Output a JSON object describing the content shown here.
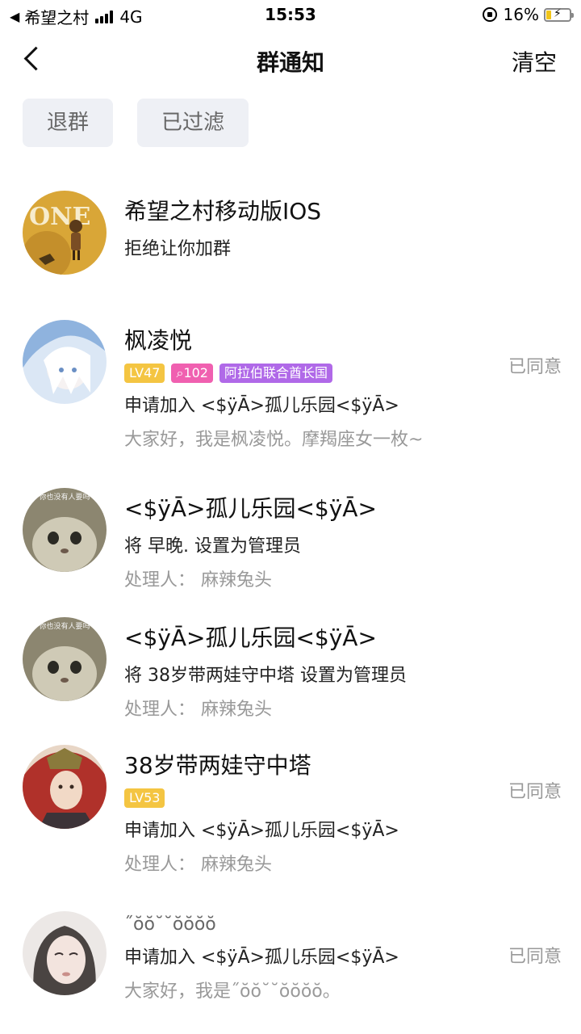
{
  "status_bar": {
    "carrier": "希望之村",
    "network": "4G",
    "time": "15:53",
    "battery": "16%"
  },
  "nav": {
    "title": "群通知",
    "clear_label": "清空"
  },
  "filters": [
    "退群",
    "已过滤"
  ],
  "colors": {
    "level_badge": "#f4c542",
    "search_badge": "#f060b0",
    "region_badge": "#b069e8",
    "chip_bg": "#eef0f5",
    "status_text": "#999999"
  },
  "items": [
    {
      "title": "希望之村移动版IOS",
      "line1": "拒绝让你加群"
    },
    {
      "title": "枫凌悦",
      "level": "LV47",
      "search_count": "102",
      "region": "阿拉伯联合酋长国",
      "line1": "申请加入 <$ÿĀ>孤儿乐园<$ÿĀ>",
      "line2": "大家好，我是枫凌悦。摩羯座女一枚~",
      "status": "已同意"
    },
    {
      "title": "<$ÿĀ>孤儿乐园<$ÿĀ>",
      "line1": "将 早晚. 设置为管理员",
      "line2": "处理人：  麻辣兔头",
      "avatar_caption": "你也没有人要吗"
    },
    {
      "title": "<$ÿĀ>孤儿乐园<$ÿĀ>",
      "line1": "将 38岁带两娃守中塔 设置为管理员",
      "line2": "处理人：  麻辣兔头",
      "avatar_caption": "你也没有人要吗"
    },
    {
      "title": "38岁带两娃守中塔",
      "level": "LV53",
      "line1": "申请加入 <$ÿĀ>孤儿乐园<$ÿĀ>",
      "line2": "处理人：  麻辣兔头",
      "status": "已同意"
    },
    {
      "title": "˝ŏŏ˘˘ŏŏŏŏ",
      "line1": "申请加入 <$ÿĀ>孤儿乐园<$ÿĀ>",
      "line2": "大家好，我是˝ŏŏ˘˘ŏŏŏŏ。",
      "status": "已同意"
    }
  ]
}
